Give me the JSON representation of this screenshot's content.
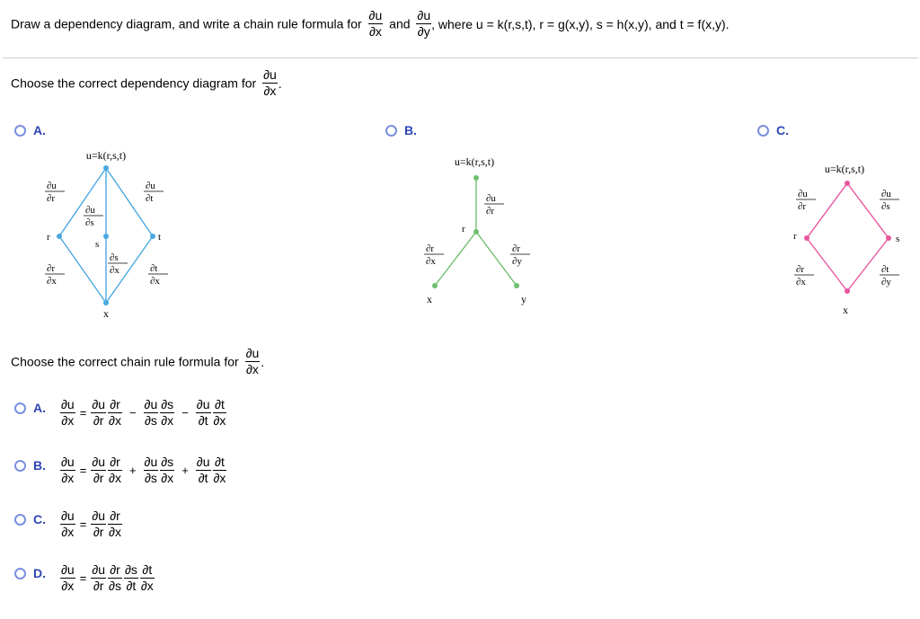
{
  "question": {
    "prefix": "Draw a dependency diagram, and write a chain rule formula for",
    "frac1": {
      "num": "∂u",
      "den": "∂x"
    },
    "mid": "and",
    "frac2": {
      "num": "∂u",
      "den": "∂y"
    },
    "suffix": ", where u = k(r,s,t), r = g(x,y), s = h(x,y), and t = f(x,y)."
  },
  "part1": {
    "prompt": "Choose the correct dependency diagram for",
    "frac": {
      "num": "∂u",
      "den": "∂x"
    },
    "end": ".",
    "options": [
      {
        "label": "A.",
        "color": "#4aa8e0",
        "top": "u=k(r,s,t)",
        "nodes": {
          "r": "r",
          "s": "s",
          "t": "t",
          "x": "x"
        },
        "edges": [
          {
            "num": "∂u",
            "den": "∂r"
          },
          {
            "num": "∂u",
            "den": "∂s"
          },
          {
            "num": "∂u",
            "den": "∂t"
          },
          {
            "num": "∂r",
            "den": "∂x"
          },
          {
            "num": "∂s",
            "den": "∂x"
          },
          {
            "num": "∂t",
            "den": "∂x"
          }
        ]
      },
      {
        "label": "B.",
        "color": "#6fbf6f",
        "top": "u=k(r,s,t)",
        "nodes": {
          "r": "r",
          "x": "x",
          "y": "y"
        },
        "edges": [
          {
            "num": "∂u",
            "den": "∂r"
          },
          {
            "num": "∂r",
            "den": "∂x"
          },
          {
            "num": "∂r",
            "den": "∂y"
          }
        ]
      },
      {
        "label": "C.",
        "color": "#e8559e",
        "top": "u=k(r,s,t)",
        "nodes": {
          "r": "r",
          "s": "s",
          "x": "x"
        },
        "edges": [
          {
            "num": "∂u",
            "den": "∂r"
          },
          {
            "num": "∂u",
            "den": "∂s"
          },
          {
            "num": "∂r",
            "den": "∂x"
          },
          {
            "num": "∂t",
            "den": "∂y"
          }
        ]
      }
    ]
  },
  "part2": {
    "prompt": "Choose the correct chain rule formula for",
    "frac": {
      "num": "∂u",
      "den": "∂x"
    },
    "end": ".",
    "options": [
      {
        "label": "A.",
        "lhs": {
          "num": "∂u",
          "den": "∂x"
        },
        "terms": [
          {
            "op": "=",
            "fracs": [
              {
                "num": "∂u",
                "den": "∂r"
              },
              {
                "num": "∂r",
                "den": "∂x"
              }
            ]
          },
          {
            "op": "−",
            "fracs": [
              {
                "num": "∂u",
                "den": "∂s"
              },
              {
                "num": "∂s",
                "den": "∂x"
              }
            ]
          },
          {
            "op": "−",
            "fracs": [
              {
                "num": "∂u",
                "den": "∂t"
              },
              {
                "num": "∂t",
                "den": "∂x"
              }
            ]
          }
        ]
      },
      {
        "label": "B.",
        "lhs": {
          "num": "∂u",
          "den": "∂x"
        },
        "terms": [
          {
            "op": "=",
            "fracs": [
              {
                "num": "∂u",
                "den": "∂r"
              },
              {
                "num": "∂r",
                "den": "∂x"
              }
            ]
          },
          {
            "op": "+",
            "fracs": [
              {
                "num": "∂u",
                "den": "∂s"
              },
              {
                "num": "∂s",
                "den": "∂x"
              }
            ]
          },
          {
            "op": "+",
            "fracs": [
              {
                "num": "∂u",
                "den": "∂t"
              },
              {
                "num": "∂t",
                "den": "∂x"
              }
            ]
          }
        ]
      },
      {
        "label": "C.",
        "lhs": {
          "num": "∂u",
          "den": "∂x"
        },
        "terms": [
          {
            "op": "=",
            "fracs": [
              {
                "num": "∂u",
                "den": "∂r"
              },
              {
                "num": "∂r",
                "den": "∂x"
              }
            ]
          }
        ]
      },
      {
        "label": "D.",
        "lhs": {
          "num": "∂u",
          "den": "∂x"
        },
        "terms": [
          {
            "op": "=",
            "fracs": [
              {
                "num": "∂u",
                "den": "∂r"
              },
              {
                "num": "∂r",
                "den": "∂s"
              },
              {
                "num": "∂s",
                "den": "∂t"
              },
              {
                "num": "∂t",
                "den": "∂x"
              }
            ]
          }
        ]
      }
    ]
  }
}
